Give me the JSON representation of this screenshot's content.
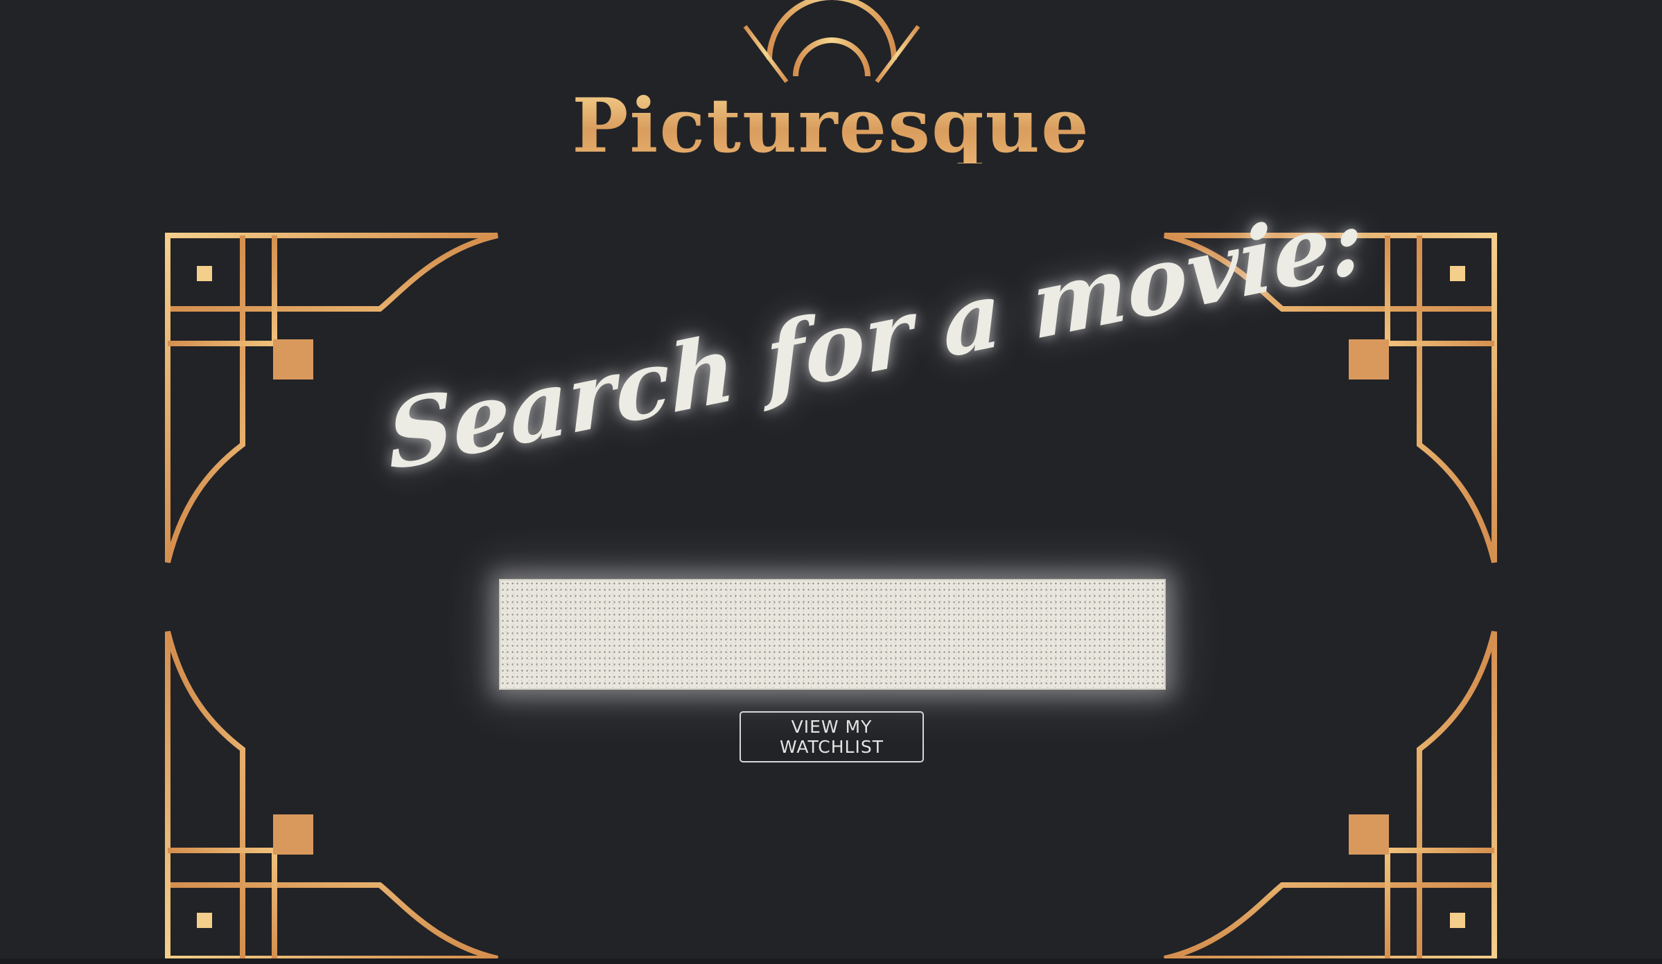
{
  "app": {
    "title": "Picturesque"
  },
  "search": {
    "heading": "Search for a movie:",
    "input_value": "",
    "placeholder": ""
  },
  "actions": {
    "watchlist_label": "VIEW MY WATCHLIST"
  },
  "icons": {
    "header_ornament": "art-deco-sunburst-icon",
    "corner_ornament": "art-deco-corner-icon"
  },
  "colors": {
    "background": "#222327",
    "gold_light": "#f4cf8b",
    "gold_dark": "#d58f4f",
    "cream": "#ecebe4"
  }
}
